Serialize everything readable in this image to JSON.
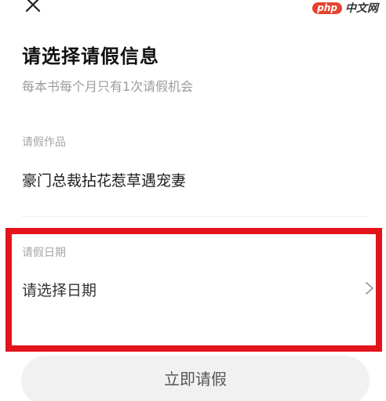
{
  "header": {
    "close_icon": "close-icon",
    "watermark": {
      "brand": "php",
      "site": "中文网",
      "brand_color": "#e8412f"
    }
  },
  "title": "请选择请假信息",
  "subtitle": "每本书每个月只有1次请假机会",
  "work": {
    "label": "请假作品",
    "value": "豪门总裁拈花惹草遇宠妻"
  },
  "date": {
    "label": "请假日期",
    "placeholder": "请选择日期",
    "chevron_icon": "chevron-right-icon"
  },
  "highlight_color": "#e4141c",
  "submit": {
    "label": "立即请假"
  }
}
